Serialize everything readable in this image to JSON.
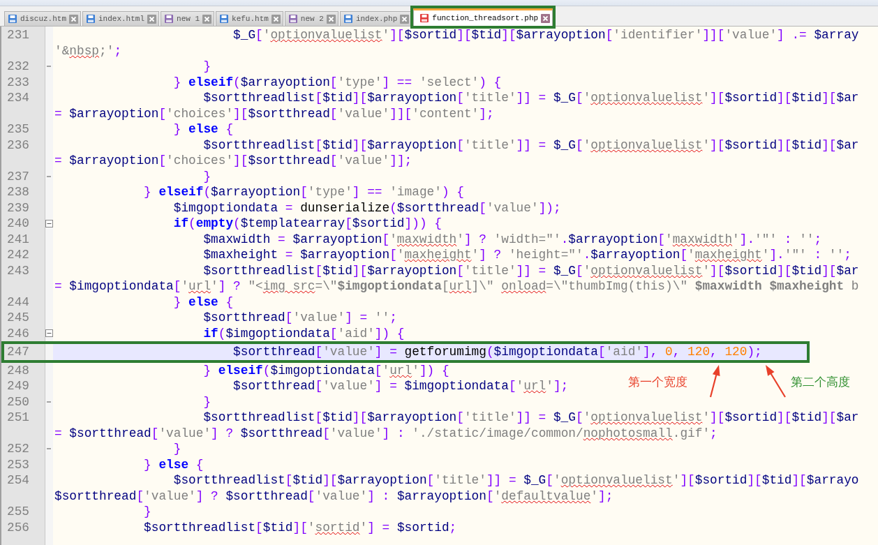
{
  "tabs": [
    {
      "label": "discuz.htm",
      "selected": false,
      "color": "#3d7fd4"
    },
    {
      "label": "index.html",
      "selected": false,
      "color": "#3d7fd4"
    },
    {
      "label": "new 1",
      "selected": false,
      "color": "#8c6bb1"
    },
    {
      "label": "kefu.htm",
      "selected": false,
      "color": "#3d7fd4"
    },
    {
      "label": "new 2",
      "selected": false,
      "color": "#8c6bb1"
    },
    {
      "label": "index.php",
      "selected": false,
      "color": "#3d7fd4"
    },
    {
      "label": "function_threadsort.php",
      "selected": true,
      "color": "#e23b3b"
    }
  ],
  "lines": [
    {
      "number": "231",
      "current": false,
      "tokens": [
        {
          "kind": "var",
          "text": "                        $_G"
        },
        {
          "kind": "op",
          "text": "["
        },
        {
          "kind": "str",
          "text": "'"
        },
        {
          "kind": "typo",
          "text": "optionvaluelist"
        },
        {
          "kind": "str",
          "text": "'"
        },
        {
          "kind": "op",
          "text": "]["
        },
        {
          "kind": "var",
          "text": "$sortid"
        },
        {
          "kind": "op",
          "text": "]["
        },
        {
          "kind": "var",
          "text": "$tid"
        },
        {
          "kind": "op",
          "text": "]["
        },
        {
          "kind": "var",
          "text": "$arrayoption"
        },
        {
          "kind": "op",
          "text": "["
        },
        {
          "kind": "str",
          "text": "'identifier'"
        },
        {
          "kind": "op",
          "text": "]]["
        },
        {
          "kind": "str",
          "text": "'value'"
        },
        {
          "kind": "op",
          "text": "] .= "
        },
        {
          "kind": "var",
          "text": "$array"
        }
      ]
    },
    {
      "current": false,
      "tokens": [
        {
          "kind": "str",
          "text": "'&"
        },
        {
          "kind": "typo",
          "text": "nbsp"
        },
        {
          "kind": "str",
          "text": ";'"
        },
        {
          "kind": "op",
          "text": ";"
        }
      ]
    },
    {
      "number": "232",
      "current": false,
      "kind": "closer",
      "tokens": [
        {
          "kind": "op",
          "text": "                    }"
        }
      ]
    },
    {
      "number": "233",
      "current": false,
      "tokens": [
        {
          "kind": "op",
          "text": "                } "
        },
        {
          "kind": "kw",
          "text": "elseif"
        },
        {
          "kind": "op",
          "text": "("
        },
        {
          "kind": "var",
          "text": "$arrayoption"
        },
        {
          "kind": "op",
          "text": "["
        },
        {
          "kind": "str",
          "text": "'type'"
        },
        {
          "kind": "op",
          "text": "] == "
        },
        {
          "kind": "str",
          "text": "'select'"
        },
        {
          "kind": "op",
          "text": ") {"
        }
      ]
    },
    {
      "number": "234",
      "current": false,
      "tokens": [
        {
          "kind": "var",
          "text": "                    $sortthreadlist"
        },
        {
          "kind": "op",
          "text": "["
        },
        {
          "kind": "var",
          "text": "$tid"
        },
        {
          "kind": "op",
          "text": "]["
        },
        {
          "kind": "var",
          "text": "$arrayoption"
        },
        {
          "kind": "op",
          "text": "["
        },
        {
          "kind": "str",
          "text": "'title'"
        },
        {
          "kind": "op",
          "text": "]] = "
        },
        {
          "kind": "var",
          "text": "$_G"
        },
        {
          "kind": "op",
          "text": "["
        },
        {
          "kind": "str",
          "text": "'"
        },
        {
          "kind": "typo",
          "text": "optionvaluelist"
        },
        {
          "kind": "str",
          "text": "'"
        },
        {
          "kind": "op",
          "text": "]["
        },
        {
          "kind": "var",
          "text": "$sortid"
        },
        {
          "kind": "op",
          "text": "]["
        },
        {
          "kind": "var",
          "text": "$tid"
        },
        {
          "kind": "op",
          "text": "]["
        },
        {
          "kind": "var",
          "text": "$ar"
        }
      ]
    },
    {
      "current": false,
      "tokens": [
        {
          "kind": "op",
          "text": "= "
        },
        {
          "kind": "var",
          "text": "$arrayoption"
        },
        {
          "kind": "op",
          "text": "["
        },
        {
          "kind": "str",
          "text": "'choices'"
        },
        {
          "kind": "op",
          "text": "]["
        },
        {
          "kind": "var",
          "text": "$sortthread"
        },
        {
          "kind": "op",
          "text": "["
        },
        {
          "kind": "str",
          "text": "'value'"
        },
        {
          "kind": "op",
          "text": "]]["
        },
        {
          "kind": "str",
          "text": "'content'"
        },
        {
          "kind": "op",
          "text": "];"
        }
      ]
    },
    {
      "number": "235",
      "current": false,
      "tokens": [
        {
          "kind": "op",
          "text": "                } "
        },
        {
          "kind": "kw",
          "text": "else"
        },
        {
          "kind": "op",
          "text": " {"
        }
      ]
    },
    {
      "number": "236",
      "current": false,
      "tokens": [
        {
          "kind": "var",
          "text": "                    $sortthreadlist"
        },
        {
          "kind": "op",
          "text": "["
        },
        {
          "kind": "var",
          "text": "$tid"
        },
        {
          "kind": "op",
          "text": "]["
        },
        {
          "kind": "var",
          "text": "$arrayoption"
        },
        {
          "kind": "op",
          "text": "["
        },
        {
          "kind": "str",
          "text": "'title'"
        },
        {
          "kind": "op",
          "text": "]] = "
        },
        {
          "kind": "var",
          "text": "$_G"
        },
        {
          "kind": "op",
          "text": "["
        },
        {
          "kind": "str",
          "text": "'"
        },
        {
          "kind": "typo",
          "text": "optionvaluelist"
        },
        {
          "kind": "str",
          "text": "'"
        },
        {
          "kind": "op",
          "text": "]["
        },
        {
          "kind": "var",
          "text": "$sortid"
        },
        {
          "kind": "op",
          "text": "]["
        },
        {
          "kind": "var",
          "text": "$tid"
        },
        {
          "kind": "op",
          "text": "]["
        },
        {
          "kind": "var",
          "text": "$ar"
        }
      ]
    },
    {
      "current": false,
      "tokens": [
        {
          "kind": "op",
          "text": "= "
        },
        {
          "kind": "var",
          "text": "$arrayoption"
        },
        {
          "kind": "op",
          "text": "["
        },
        {
          "kind": "str",
          "text": "'choices'"
        },
        {
          "kind": "op",
          "text": "]["
        },
        {
          "kind": "var",
          "text": "$sortthread"
        },
        {
          "kind": "op",
          "text": "["
        },
        {
          "kind": "str",
          "text": "'value'"
        },
        {
          "kind": "op",
          "text": "]];"
        }
      ]
    },
    {
      "number": "237",
      "current": false,
      "kind": "closer",
      "tokens": [
        {
          "kind": "op",
          "text": "                    }"
        }
      ]
    },
    {
      "number": "238",
      "current": false,
      "tokens": [
        {
          "kind": "op",
          "text": "            } "
        },
        {
          "kind": "kw",
          "text": "elseif"
        },
        {
          "kind": "op",
          "text": "("
        },
        {
          "kind": "var",
          "text": "$arrayoption"
        },
        {
          "kind": "op",
          "text": "["
        },
        {
          "kind": "str",
          "text": "'type'"
        },
        {
          "kind": "op",
          "text": "] == "
        },
        {
          "kind": "str",
          "text": "'image'"
        },
        {
          "kind": "op",
          "text": ") {"
        }
      ]
    },
    {
      "number": "239",
      "current": false,
      "tokens": [
        {
          "kind": "var",
          "text": "                $imgoptiondata"
        },
        {
          "kind": "op",
          "text": " = "
        },
        {
          "kind": "fn",
          "text": "dunserialize"
        },
        {
          "kind": "op",
          "text": "("
        },
        {
          "kind": "var",
          "text": "$sortthread"
        },
        {
          "kind": "op",
          "text": "["
        },
        {
          "kind": "str",
          "text": "'value'"
        },
        {
          "kind": "op",
          "text": "]);"
        }
      ]
    },
    {
      "number": "240",
      "current": false,
      "kind": "opener",
      "tokens": [
        {
          "kind": "kw",
          "text": "                if"
        },
        {
          "kind": "op",
          "text": "("
        },
        {
          "kind": "kw",
          "text": "empty"
        },
        {
          "kind": "op",
          "text": "("
        },
        {
          "kind": "var",
          "text": "$templatearray"
        },
        {
          "kind": "op",
          "text": "["
        },
        {
          "kind": "var",
          "text": "$sortid"
        },
        {
          "kind": "op",
          "text": "])) {"
        }
      ]
    },
    {
      "number": "241",
      "current": false,
      "tokens": [
        {
          "kind": "var",
          "text": "                    $maxwidth"
        },
        {
          "kind": "op",
          "text": " = "
        },
        {
          "kind": "var",
          "text": "$arrayoption"
        },
        {
          "kind": "op",
          "text": "["
        },
        {
          "kind": "str",
          "text": "'"
        },
        {
          "kind": "typo",
          "text": "maxwidth"
        },
        {
          "kind": "str",
          "text": "'"
        },
        {
          "kind": "op",
          "text": "] ? "
        },
        {
          "kind": "str",
          "text": "'width=\"'"
        },
        {
          "kind": "op",
          "text": "."
        },
        {
          "kind": "var",
          "text": "$arrayoption"
        },
        {
          "kind": "op",
          "text": "["
        },
        {
          "kind": "str",
          "text": "'"
        },
        {
          "kind": "typo",
          "text": "maxwidth"
        },
        {
          "kind": "str",
          "text": "'"
        },
        {
          "kind": "op",
          "text": "]."
        },
        {
          "kind": "str",
          "text": "'\"'"
        },
        {
          "kind": "op",
          "text": " : "
        },
        {
          "kind": "str",
          "text": "''"
        },
        {
          "kind": "op",
          "text": ";"
        }
      ]
    },
    {
      "number": "242",
      "current": false,
      "tokens": [
        {
          "kind": "var",
          "text": "                    $maxheight"
        },
        {
          "kind": "op",
          "text": " = "
        },
        {
          "kind": "var",
          "text": "$arrayoption"
        },
        {
          "kind": "op",
          "text": "["
        },
        {
          "kind": "str",
          "text": "'"
        },
        {
          "kind": "typo",
          "text": "maxheight"
        },
        {
          "kind": "str",
          "text": "'"
        },
        {
          "kind": "op",
          "text": "] ? "
        },
        {
          "kind": "str",
          "text": "'height=\"'"
        },
        {
          "kind": "op",
          "text": "."
        },
        {
          "kind": "var",
          "text": "$arrayoption"
        },
        {
          "kind": "op",
          "text": "["
        },
        {
          "kind": "str",
          "text": "'"
        },
        {
          "kind": "typo",
          "text": "maxheight"
        },
        {
          "kind": "str",
          "text": "'"
        },
        {
          "kind": "op",
          "text": "]."
        },
        {
          "kind": "str",
          "text": "'\"'"
        },
        {
          "kind": "op",
          "text": " : "
        },
        {
          "kind": "str",
          "text": "''"
        },
        {
          "kind": "op",
          "text": ";"
        }
      ]
    },
    {
      "number": "243",
      "current": false,
      "tokens": [
        {
          "kind": "var",
          "text": "                    $sortthreadlist"
        },
        {
          "kind": "op",
          "text": "["
        },
        {
          "kind": "var",
          "text": "$tid"
        },
        {
          "kind": "op",
          "text": "]["
        },
        {
          "kind": "var",
          "text": "$arrayoption"
        },
        {
          "kind": "op",
          "text": "["
        },
        {
          "kind": "str",
          "text": "'title'"
        },
        {
          "kind": "op",
          "text": "]] = "
        },
        {
          "kind": "var",
          "text": "$_G"
        },
        {
          "kind": "op",
          "text": "["
        },
        {
          "kind": "str",
          "text": "'"
        },
        {
          "kind": "typo",
          "text": "optionvaluelist"
        },
        {
          "kind": "str",
          "text": "'"
        },
        {
          "kind": "op",
          "text": "]["
        },
        {
          "kind": "var",
          "text": "$sortid"
        },
        {
          "kind": "op",
          "text": "]["
        },
        {
          "kind": "var",
          "text": "$tid"
        },
        {
          "kind": "op",
          "text": "]["
        },
        {
          "kind": "var",
          "text": "$ar"
        }
      ]
    },
    {
      "current": false,
      "tokens": [
        {
          "kind": "op",
          "text": "= "
        },
        {
          "kind": "var",
          "text": "$imgoptiondata"
        },
        {
          "kind": "op",
          "text": "["
        },
        {
          "kind": "str",
          "text": "'"
        },
        {
          "kind": "typo",
          "text": "url"
        },
        {
          "kind": "str",
          "text": "'"
        },
        {
          "kind": "op",
          "text": "] ? "
        },
        {
          "kind": "str",
          "text": "\"<"
        },
        {
          "kind": "typo",
          "text": "img src"
        },
        {
          "kind": "str",
          "text": "=\\\""
        },
        {
          "kind": "bold",
          "text": "$imgoptiondata"
        },
        {
          "kind": "str",
          "text": "["
        },
        {
          "kind": "typo",
          "text": "url"
        },
        {
          "kind": "str",
          "text": "]\\\" "
        },
        {
          "kind": "typo",
          "text": "onload"
        },
        {
          "kind": "str",
          "text": "=\\\"thumbImg(this)\\\" "
        },
        {
          "kind": "bold",
          "text": "$maxwidth $maxheight"
        },
        {
          "kind": "str",
          "text": " b"
        }
      ]
    },
    {
      "number": "244",
      "current": false,
      "tokens": [
        {
          "kind": "op",
          "text": "                } "
        },
        {
          "kind": "kw",
          "text": "else"
        },
        {
          "kind": "op",
          "text": " {"
        }
      ]
    },
    {
      "number": "245",
      "current": false,
      "tokens": [
        {
          "kind": "var",
          "text": "                    $sortthread"
        },
        {
          "kind": "op",
          "text": "["
        },
        {
          "kind": "str",
          "text": "'value'"
        },
        {
          "kind": "op",
          "text": "] = "
        },
        {
          "kind": "str",
          "text": "''"
        },
        {
          "kind": "op",
          "text": ";"
        }
      ]
    },
    {
      "number": "246",
      "current": false,
      "kind": "opener",
      "tokens": [
        {
          "kind": "kw",
          "text": "                    if"
        },
        {
          "kind": "op",
          "text": "("
        },
        {
          "kind": "var",
          "text": "$imgoptiondata"
        },
        {
          "kind": "op",
          "text": "["
        },
        {
          "kind": "str",
          "text": "'aid'"
        },
        {
          "kind": "op",
          "text": "]) {"
        }
      ]
    },
    {
      "number": "247",
      "current": true,
      "tokens": [
        {
          "kind": "var",
          "text": "                        $sortthread"
        },
        {
          "kind": "op",
          "text": "["
        },
        {
          "kind": "str",
          "text": "'value'"
        },
        {
          "kind": "op",
          "text": "] = "
        },
        {
          "kind": "fn",
          "text": "getforumimg"
        },
        {
          "kind": "op",
          "text": "("
        },
        {
          "kind": "var",
          "text": "$imgoptiondata"
        },
        {
          "kind": "op",
          "text": "["
        },
        {
          "kind": "str",
          "text": "'aid'"
        },
        {
          "kind": "op",
          "text": "], "
        },
        {
          "kind": "num",
          "text": "0"
        },
        {
          "kind": "op",
          "text": ", "
        },
        {
          "kind": "num",
          "text": "120"
        },
        {
          "kind": "op",
          "text": ", "
        },
        {
          "kind": "num",
          "text": "120"
        },
        {
          "kind": "op",
          "text": ");"
        }
      ]
    },
    {
      "number": "248",
      "current": false,
      "tokens": [
        {
          "kind": "op",
          "text": "                    } "
        },
        {
          "kind": "kw",
          "text": "elseif"
        },
        {
          "kind": "op",
          "text": "("
        },
        {
          "kind": "var",
          "text": "$imgoptiondata"
        },
        {
          "kind": "op",
          "text": "["
        },
        {
          "kind": "str",
          "text": "'"
        },
        {
          "kind": "typo",
          "text": "url"
        },
        {
          "kind": "str",
          "text": "'"
        },
        {
          "kind": "op",
          "text": "]) {"
        }
      ]
    },
    {
      "number": "249",
      "current": false,
      "tokens": [
        {
          "kind": "var",
          "text": "                        $sortthread"
        },
        {
          "kind": "op",
          "text": "["
        },
        {
          "kind": "str",
          "text": "'value'"
        },
        {
          "kind": "op",
          "text": "] = "
        },
        {
          "kind": "var",
          "text": "$imgoptiondata"
        },
        {
          "kind": "op",
          "text": "["
        },
        {
          "kind": "str",
          "text": "'"
        },
        {
          "kind": "typo",
          "text": "url"
        },
        {
          "kind": "str",
          "text": "'"
        },
        {
          "kind": "op",
          "text": "];"
        }
      ]
    },
    {
      "number": "250",
      "current": false,
      "kind": "closer",
      "tokens": [
        {
          "kind": "op",
          "text": "                    }"
        }
      ]
    },
    {
      "number": "251",
      "current": false,
      "tokens": [
        {
          "kind": "var",
          "text": "                    $sortthreadlist"
        },
        {
          "kind": "op",
          "text": "["
        },
        {
          "kind": "var",
          "text": "$tid"
        },
        {
          "kind": "op",
          "text": "]["
        },
        {
          "kind": "var",
          "text": "$arrayoption"
        },
        {
          "kind": "op",
          "text": "["
        },
        {
          "kind": "str",
          "text": "'title'"
        },
        {
          "kind": "op",
          "text": "]] = "
        },
        {
          "kind": "var",
          "text": "$_G"
        },
        {
          "kind": "op",
          "text": "["
        },
        {
          "kind": "str",
          "text": "'"
        },
        {
          "kind": "typo",
          "text": "optionvaluelist"
        },
        {
          "kind": "str",
          "text": "'"
        },
        {
          "kind": "op",
          "text": "]["
        },
        {
          "kind": "var",
          "text": "$sortid"
        },
        {
          "kind": "op",
          "text": "]["
        },
        {
          "kind": "var",
          "text": "$tid"
        },
        {
          "kind": "op",
          "text": "]["
        },
        {
          "kind": "var",
          "text": "$ar"
        }
      ]
    },
    {
      "current": false,
      "tokens": [
        {
          "kind": "op",
          "text": "= "
        },
        {
          "kind": "var",
          "text": "$sortthread"
        },
        {
          "kind": "op",
          "text": "["
        },
        {
          "kind": "str",
          "text": "'value'"
        },
        {
          "kind": "op",
          "text": "] ? "
        },
        {
          "kind": "var",
          "text": "$sortthread"
        },
        {
          "kind": "op",
          "text": "["
        },
        {
          "kind": "str",
          "text": "'value'"
        },
        {
          "kind": "op",
          "text": "] : "
        },
        {
          "kind": "str",
          "text": "'./static/image/common/"
        },
        {
          "kind": "typo",
          "text": "nophotosmall"
        },
        {
          "kind": "str",
          "text": ".gif'"
        },
        {
          "kind": "op",
          "text": ";"
        }
      ]
    },
    {
      "number": "252",
      "current": false,
      "kind": "closer",
      "tokens": [
        {
          "kind": "op",
          "text": "                }"
        }
      ]
    },
    {
      "number": "253",
      "current": false,
      "tokens": [
        {
          "kind": "op",
          "text": "            } "
        },
        {
          "kind": "kw",
          "text": "else"
        },
        {
          "kind": "op",
          "text": " {"
        }
      ]
    },
    {
      "number": "254",
      "current": false,
      "tokens": [
        {
          "kind": "var",
          "text": "                $sortthreadlist"
        },
        {
          "kind": "op",
          "text": "["
        },
        {
          "kind": "var",
          "text": "$tid"
        },
        {
          "kind": "op",
          "text": "]["
        },
        {
          "kind": "var",
          "text": "$arrayoption"
        },
        {
          "kind": "op",
          "text": "["
        },
        {
          "kind": "str",
          "text": "'title'"
        },
        {
          "kind": "op",
          "text": "]] = "
        },
        {
          "kind": "var",
          "text": "$_G"
        },
        {
          "kind": "op",
          "text": "["
        },
        {
          "kind": "str",
          "text": "'"
        },
        {
          "kind": "typo",
          "text": "optionvaluelist"
        },
        {
          "kind": "str",
          "text": "'"
        },
        {
          "kind": "op",
          "text": "]["
        },
        {
          "kind": "var",
          "text": "$sortid"
        },
        {
          "kind": "op",
          "text": "]["
        },
        {
          "kind": "var",
          "text": "$tid"
        },
        {
          "kind": "op",
          "text": "]["
        },
        {
          "kind": "var",
          "text": "$arrayo"
        }
      ]
    },
    {
      "current": false,
      "tokens": [
        {
          "kind": "var",
          "text": "$sortthread"
        },
        {
          "kind": "op",
          "text": "["
        },
        {
          "kind": "str",
          "text": "'value'"
        },
        {
          "kind": "op",
          "text": "] ? "
        },
        {
          "kind": "var",
          "text": "$sortthread"
        },
        {
          "kind": "op",
          "text": "["
        },
        {
          "kind": "str",
          "text": "'value'"
        },
        {
          "kind": "op",
          "text": "] : "
        },
        {
          "kind": "var",
          "text": "$arrayoption"
        },
        {
          "kind": "op",
          "text": "["
        },
        {
          "kind": "str",
          "text": "'"
        },
        {
          "kind": "typo",
          "text": "defaultvalue"
        },
        {
          "kind": "str",
          "text": "'"
        },
        {
          "kind": "op",
          "text": "];"
        }
      ]
    },
    {
      "number": "255",
      "current": false,
      "tokens": [
        {
          "kind": "op",
          "text": "            }"
        }
      ]
    },
    {
      "number": "256",
      "current": false,
      "tokens": [
        {
          "kind": "var",
          "text": "            $sortthreadlist"
        },
        {
          "kind": "op",
          "text": "["
        },
        {
          "kind": "var",
          "text": "$tid"
        },
        {
          "kind": "op",
          "text": "]["
        },
        {
          "kind": "str",
          "text": "'"
        },
        {
          "kind": "typo",
          "text": "sortid"
        },
        {
          "kind": "str",
          "text": "'"
        },
        {
          "kind": "op",
          "text": "] = "
        },
        {
          "kind": "var",
          "text": "$sortid"
        },
        {
          "kind": "op",
          "text": ";"
        }
      ]
    }
  ],
  "annotations": [
    {
      "text": "第一个宽度",
      "color": "#e8402a"
    },
    {
      "text": "第二个高度",
      "color": "#2f8f2f"
    }
  ]
}
